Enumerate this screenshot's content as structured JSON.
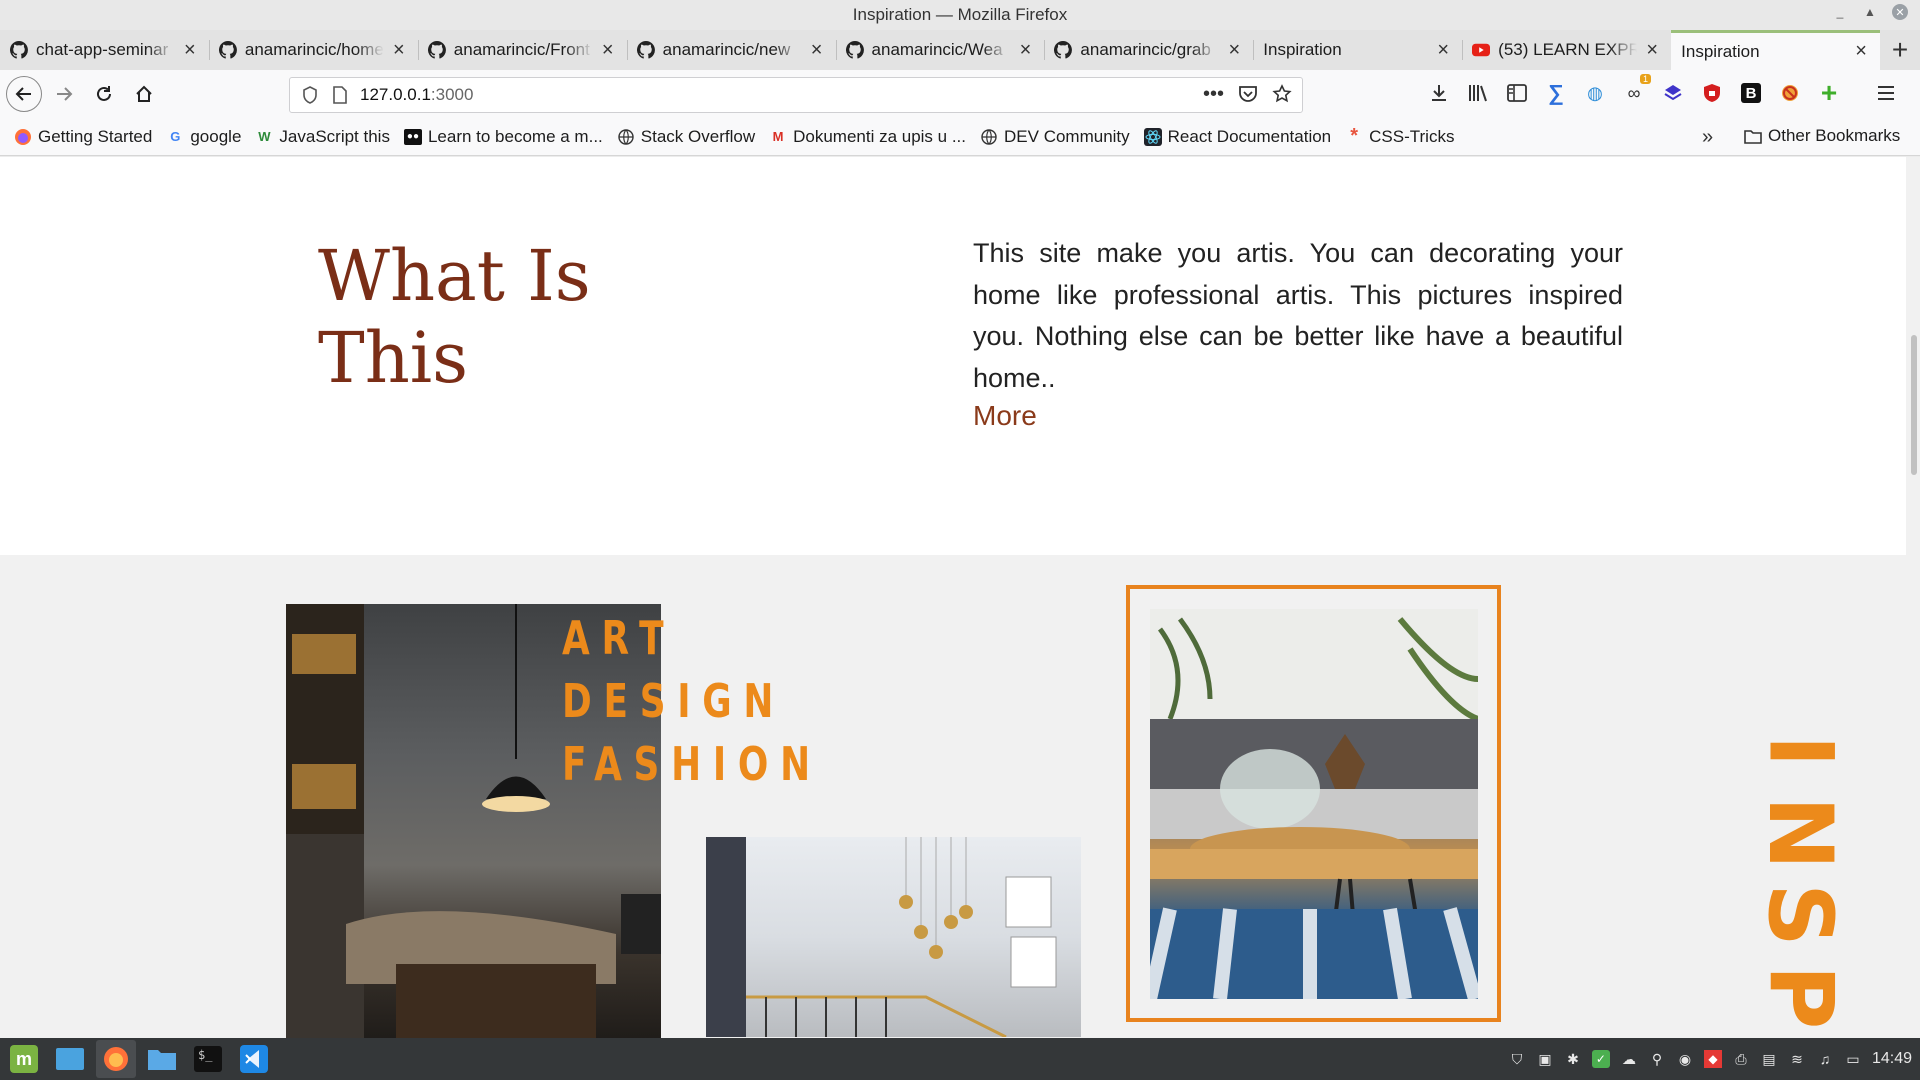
{
  "window": {
    "title": "Inspiration — Mozilla Firefox"
  },
  "tabs": [
    {
      "label": "chat-app-seminar",
      "icon": "github-icon"
    },
    {
      "label": "anamarincic/home",
      "icon": "github-icon"
    },
    {
      "label": "anamarincic/Front",
      "icon": "github-icon"
    },
    {
      "label": "anamarincic/new",
      "icon": "github-icon"
    },
    {
      "label": "anamarincic/Wea",
      "icon": "github-icon"
    },
    {
      "label": "anamarincic/grab",
      "icon": "github-icon"
    },
    {
      "label": "Inspiration",
      "icon": "none"
    },
    {
      "label": "(53) LEARN EXPR",
      "icon": "youtube-icon"
    },
    {
      "label": "Inspiration",
      "icon": "none",
      "active": true
    }
  ],
  "navbar": {
    "url_host": "127.0.0.1",
    "url_port": ":3000",
    "extension_badge": "1"
  },
  "bookmarks": [
    {
      "label": "Getting Started",
      "icon": "firefox-icon"
    },
    {
      "label": "google",
      "icon": "google-icon"
    },
    {
      "label": "JavaScript this",
      "icon": "w3-icon"
    },
    {
      "label": "Learn to become a m...",
      "icon": "dev-icon"
    },
    {
      "label": "Stack Overflow",
      "icon": "globe-icon"
    },
    {
      "label": "Dokumenti za upis u ...",
      "icon": "gmail-icon"
    },
    {
      "label": "DEV Community",
      "icon": "globe-icon"
    },
    {
      "label": "React Documentation",
      "icon": "react-icon"
    },
    {
      "label": "CSS-Tricks",
      "icon": "asterisk-icon"
    }
  ],
  "bookmarks_other": "Other Bookmarks",
  "page": {
    "what_title": "What Is This",
    "what_text": "This site make you artis. You can decorating your home like professional artis. This pictures inspired you. Nothing else can be better like have a beautiful home..",
    "what_more": "More",
    "art_words": [
      "ART",
      "DESIGN",
      "FASHION"
    ],
    "side_word": "INSPI",
    "accent_color": "#ec8a1b",
    "title_color": "#7a2e17"
  },
  "taskbar": {
    "clock": "14:49"
  }
}
